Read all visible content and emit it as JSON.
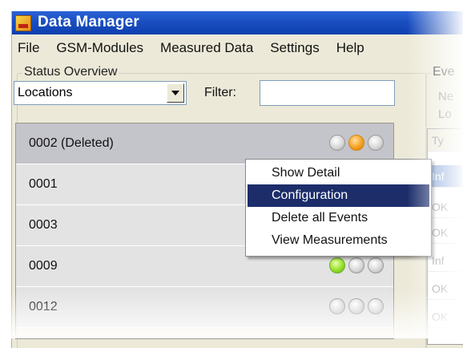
{
  "window": {
    "title": "Data Manager",
    "icon": "data-manager-app-icon"
  },
  "menu": [
    "File",
    "GSM-Modules",
    "Measured Data",
    "Settings",
    "Help"
  ],
  "status_overview": {
    "legend": "Status Overview",
    "dropdown_value": "Locations",
    "filter_label": "Filter:",
    "filter_value": "",
    "rows": [
      {
        "label": "0002 (Deleted)",
        "lights": [
          "off",
          "orange",
          "off"
        ],
        "selected": true
      },
      {
        "label": "0001",
        "lights": []
      },
      {
        "label": "0003",
        "lights": []
      },
      {
        "label": "0009",
        "lights": [
          "green",
          "off",
          "off"
        ]
      },
      {
        "label": "0012",
        "lights": [
          "off",
          "off",
          "off"
        ]
      }
    ]
  },
  "context_menu": {
    "items": [
      {
        "label": "Show Detail",
        "highlighted": false
      },
      {
        "label": "Configuration",
        "highlighted": true
      },
      {
        "label": "Delete all Events",
        "highlighted": false
      },
      {
        "label": "View Measurements",
        "highlighted": false
      }
    ]
  },
  "events_panel": {
    "legend": "Eve",
    "line1": "Ne",
    "line2": "Lo",
    "header": "Ty",
    "cells": [
      "Inf",
      "OK",
      "OK",
      "Inf",
      "OK",
      "OK"
    ]
  },
  "colors": {
    "titlebar": "#1a4fc1",
    "window_bg": "#ece9d8",
    "row_selected": "#c0c0c6",
    "row_normal": "#e1e1e1",
    "menu_highlight": "#1c2d6a",
    "light_green": "#98e02a",
    "light_orange": "#f5a020"
  }
}
